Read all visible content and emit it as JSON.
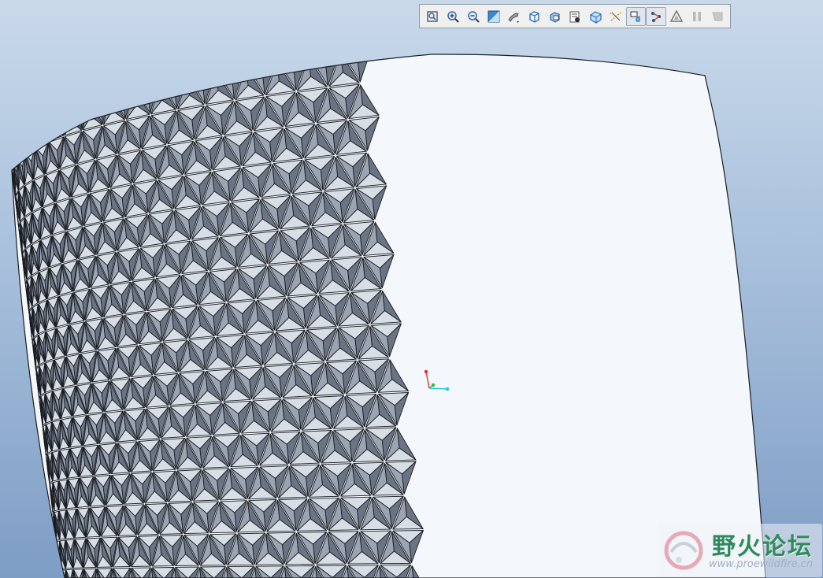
{
  "window": {
    "title": ""
  },
  "toolbar": {
    "buttons": [
      {
        "id": "refit",
        "icon": "refit-icon",
        "active": false
      },
      {
        "id": "zoom-in",
        "icon": "zoom-in-icon",
        "active": false
      },
      {
        "id": "zoom-out",
        "icon": "zoom-out-icon",
        "active": false
      },
      {
        "id": "repaint",
        "icon": "repaint-icon",
        "active": false
      },
      {
        "id": "display-style",
        "icon": "display-style-icon",
        "active": false
      },
      {
        "id": "saved-orientations",
        "icon": "saved-views-icon",
        "active": false
      },
      {
        "id": "view-manager",
        "icon": "view-manager-icon",
        "active": false
      },
      {
        "id": "perspective",
        "icon": "perspective-icon",
        "active": false
      },
      {
        "id": "named-view",
        "icon": "named-view-icon",
        "active": false
      },
      {
        "id": "datum-display",
        "icon": "datum-display-icon",
        "active": false
      },
      {
        "id": "annotation-display",
        "icon": "annotation-display-icon",
        "active": true
      },
      {
        "id": "spin-center",
        "icon": "spin-center-icon",
        "active": true
      },
      {
        "id": "regenerate",
        "icon": "regenerate-icon",
        "active": false
      },
      {
        "id": "pause",
        "icon": "pause-icon",
        "active": false,
        "disabled": true
      },
      {
        "id": "stop",
        "icon": "stop-icon",
        "active": false,
        "disabled": true
      }
    ]
  },
  "model": {
    "kind": "triangular pyramid lattice surface",
    "face_color": "#9ba4b2",
    "light_face_color": "#d8dee6",
    "dark_face_color": "#6a7484",
    "gap_color": "#f4f8fc",
    "edge_color": "#1a1d22"
  },
  "triad": {
    "x_color": "#22c8d8",
    "y_color": "#e03030",
    "z_color": "#2db84a"
  },
  "watermark": {
    "title": "野火论坛",
    "url": "www.proewildfire.cn"
  },
  "colors": {
    "viewport_top": "#c9d9ea",
    "viewport_bottom": "#7e9dc5"
  }
}
